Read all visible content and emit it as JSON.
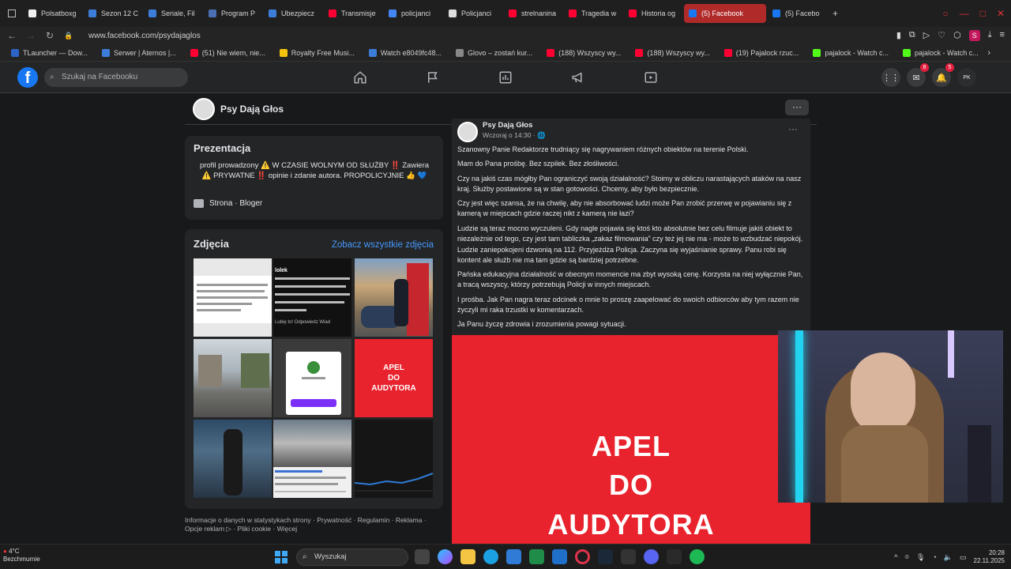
{
  "browser": {
    "tabs": [
      {
        "label": "Polsatboxg",
        "color": "#f0f0f0"
      },
      {
        "label": "Sezon 12 C",
        "color": "#3c7dd9"
      },
      {
        "label": "Seriale, Fil",
        "color": "#3c7dd9"
      },
      {
        "label": "Program P",
        "color": "#4a6fb3"
      },
      {
        "label": "Ubezpiecz",
        "color": "#3c7dd9"
      },
      {
        "label": "Transmisje",
        "color": "#ff0033"
      },
      {
        "label": "policjanci",
        "color": "#4285f4"
      },
      {
        "label": "Policjanci",
        "color": "#dddddd"
      },
      {
        "label": "strelnanina",
        "color": "#ff0033"
      },
      {
        "label": "Tragedia w",
        "color": "#ff0033"
      },
      {
        "label": "Historia og",
        "color": "#ff0033"
      },
      {
        "label": "(5) Facebook",
        "color": "#1877f2",
        "active": true
      },
      {
        "label": "(5) Facebo",
        "color": "#1877f2"
      }
    ],
    "url": "www.facebook.com/psydajaglos",
    "bookmarks": [
      {
        "label": "TLauncher — Dow...",
        "color": "#2b63c6"
      },
      {
        "label": "Serwer | Aternos |...",
        "color": "#3c7dd9"
      },
      {
        "label": "(51) Nie wiem, nie...",
        "color": "#ff0033"
      },
      {
        "label": "Royalty Free Musi...",
        "color": "#f4c20d"
      },
      {
        "label": "Watch e8049fc48...",
        "color": "#3c7dd9"
      },
      {
        "label": "Glovo – zostań kur...",
        "color": "#888888"
      },
      {
        "label": "(188) Wszyscy wy...",
        "color": "#ff0033"
      },
      {
        "label": "(188) Wszyscy wy...",
        "color": "#ff0033"
      },
      {
        "label": "(19) Pajalock rzuc...",
        "color": "#ff0033"
      },
      {
        "label": "pajalock - Watch c...",
        "color": "#53fc18"
      },
      {
        "label": "pajalock - Watch c...",
        "color": "#53fc18"
      }
    ],
    "profile_initial": "S"
  },
  "fb": {
    "search_placeholder": "Szukaj na Facebooku",
    "messenger_badge": "8",
    "notif_badge": "5",
    "avatar_initials": "PK"
  },
  "page": {
    "name": "Psy Dają Głos",
    "intro": {
      "title": "Prezentacja",
      "line1": "profil prowadzony ⚠️ W CZASIE WOLNYM OD SŁUŻBY ‼️ Zawiera",
      "line2": "⚠️ PRYWATNE ‼️ opinie i zdanie autora. PROPOLICYJNIE 👍 💙",
      "category": "Strona · Bloger"
    },
    "photos": {
      "title": "Zdjęcia",
      "see_all": "Zobacz wszystkie zdjęcia",
      "tile_apel_1": "APEL",
      "tile_apel_2": "DO",
      "tile_apel_3": "AUDYTORA",
      "tile2_title": "lolek",
      "tile2_actions": "Lubię to!   Odpowiedz   Wiad"
    },
    "footer": {
      "line1": "Informacje o danych w statystykach strony · Prywatność · Regulamin · Reklama ·",
      "line2": "Opcje reklam ▷ · Pliki cookie · Więcej"
    }
  },
  "post": {
    "author": "Psy Dają Głos",
    "time": "Wczoraj o 14:30 · 🌐",
    "paragraphs": [
      "Szanowny Panie Redaktorze trudniący się nagrywaniem różnych obiektów na terenie Polski.",
      "Mam do Pana prośbę. Bez szpilek. Bez złośliwości.",
      "Czy na jakiś czas mógłby Pan ograniczyć swoją działalność? Stoimy w obliczu narastających ataków na nasz kraj. Służby postawione są w stan gotowości. Chcemy, aby było bezpiecznie.",
      "Czy jest więc szansa, że na chwilę, aby nie absorbować ludzi może Pan zrobić przerwę w pojawianiu się z kamerą w miejscach gdzie raczej nikt z kamerą nie łazi?",
      "Ludzie są teraz mocno wyczuleni. Gdy nagle pojawia się ktoś kto absolutnie bez celu filmuje jakiś obiekt to niezależnie od tego, czy jest tam tabliczka „zakaz filmowania” czy też jej nie ma - może to wzbudzać niepokój. Ludzie zaniepokojeni dzwonią na 112. Przyjeżdża Policja. Zaczyna się wyjaśnianie sprawy. Panu robi się kontent ale służb nie ma tam gdzie są bardziej potrzebne.",
      "Pańska edukacyjna działalność w obecnym momencie ma zbyt wysoką cenę. Korzysta na niej wyłącznie Pan, a tracą wszyscy, którzy potrzebują Policji w innych miejscach.",
      "I prośba. Jak Pan nagra teraz odcinek o mnie to proszę zaapelować do swoich odbiorców aby tym razem nie życzyli mi raka trzustki w komentarzach.",
      "Ja Panu życzę zdrowia i zrozumienia powagi sytuacji."
    ],
    "image_line1": "APEL",
    "image_line2": "DO",
    "image_line3": "AUDYTORA"
  },
  "taskbar": {
    "weather_temp": "4°C",
    "weather_desc": "Bezchmurnie",
    "search_placeholder": "Wyszukaj",
    "time": "20:28",
    "date": "22.11.2025"
  }
}
